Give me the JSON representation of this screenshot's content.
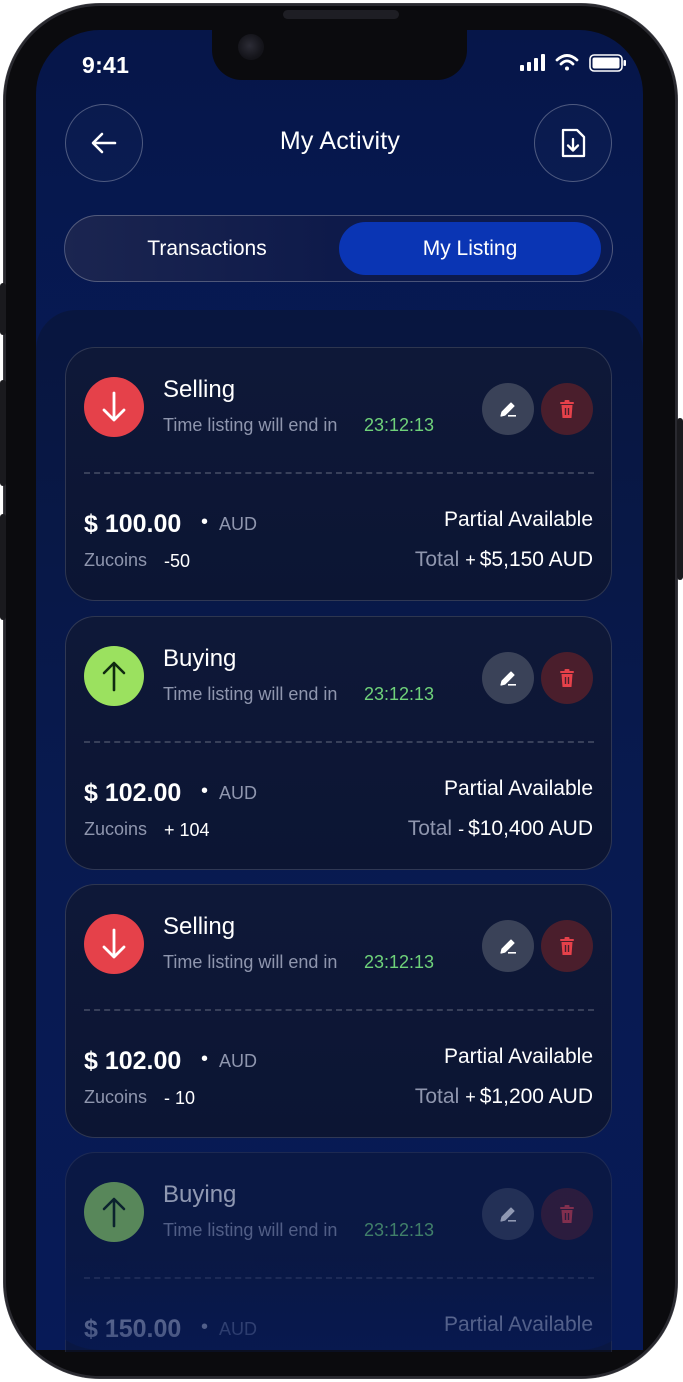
{
  "status_bar": {
    "time": "9:41"
  },
  "header": {
    "title": "My Activity"
  },
  "tabs": [
    {
      "label": "Transactions",
      "active": false
    },
    {
      "label": "My Listing",
      "active": true
    }
  ],
  "listings": [
    {
      "type": "sell",
      "title": "Selling",
      "subtitle": "Time listing will end in",
      "timer": "23:12:13",
      "price": "$ 100.00",
      "dot": "•",
      "currency": "AUD",
      "zucoins_label": "Zucoins",
      "zucoins_value": "-50",
      "availability": "Partial Available",
      "total_label": "Total",
      "total_sign": "+",
      "total_value": "$5,150 AUD"
    },
    {
      "type": "buy",
      "title": "Buying",
      "subtitle": "Time listing will end in",
      "timer": "23:12:13",
      "price": "$ 102.00",
      "dot": "•",
      "currency": "AUD",
      "zucoins_label": "Zucoins",
      "zucoins_value": "+ 104",
      "availability": "Partial Available",
      "total_label": "Total",
      "total_sign": "-",
      "total_value": "$10,400 AUD"
    },
    {
      "type": "sell",
      "title": "Selling",
      "subtitle": "Time listing will end in",
      "timer": "23:12:13",
      "price": "$ 102.00",
      "dot": "•",
      "currency": "AUD",
      "zucoins_label": "Zucoins",
      "zucoins_value": "- 10",
      "availability": "Partial Available",
      "total_label": "Total",
      "total_sign": "+",
      "total_value": "$1,200 AUD"
    },
    {
      "type": "buy",
      "title": "Buying",
      "subtitle": "Time listing will end in",
      "timer": "23:12:13",
      "price": "$ 150.00",
      "dot": "•",
      "currency": "AUD",
      "availability": "Partial Available"
    }
  ],
  "colors": {
    "sell": "#e5414a",
    "buy": "#9be15f",
    "timer": "#6fd27a",
    "active_tab": "#0a35b4"
  },
  "icons": {
    "back": "arrow-left-icon",
    "download": "document-download-icon",
    "edit": "pencil-icon",
    "delete": "trash-icon",
    "sell": "arrow-down-icon",
    "buy": "arrow-up-icon"
  }
}
